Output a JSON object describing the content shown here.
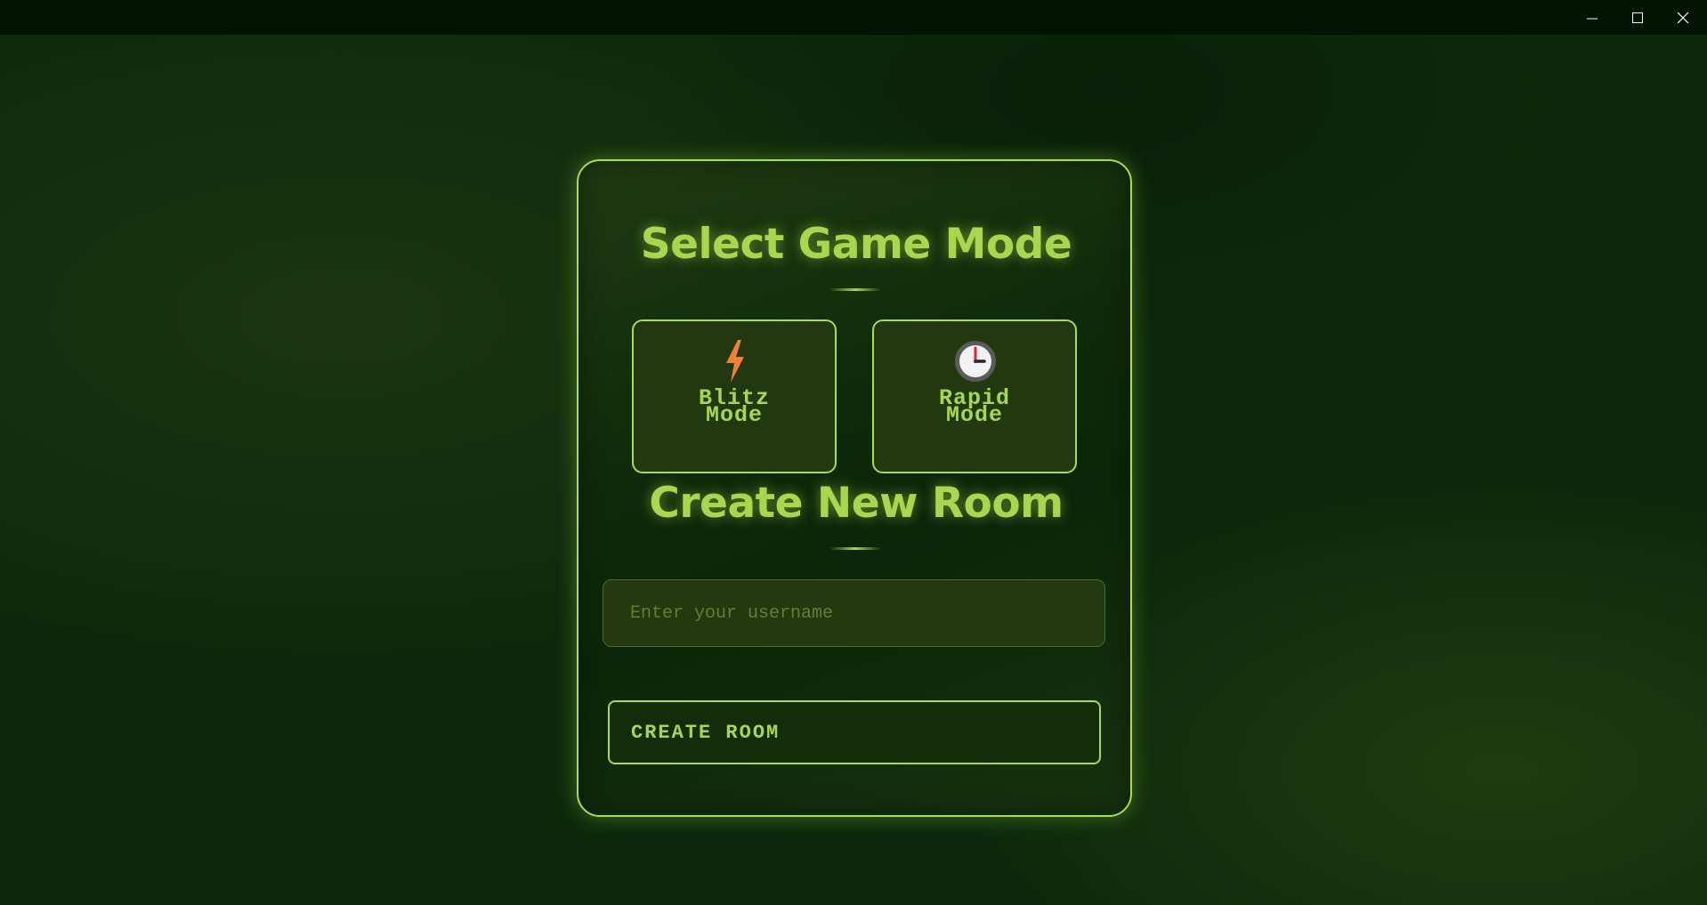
{
  "window": {
    "controls": [
      {
        "icon": "minimize-icon"
      },
      {
        "icon": "maximize-icon"
      },
      {
        "icon": "close-icon"
      }
    ]
  },
  "colors": {
    "accent": "#a7d84c",
    "lightning": "#f2802f",
    "background": "#0c2a0b"
  },
  "mode_section": {
    "title": "Select Game Mode",
    "modes": [
      {
        "icon": "lightning-icon",
        "line1": "Blitz",
        "line2": "Mode"
      },
      {
        "icon": "clock-icon",
        "line1": "Rapid",
        "line2": "Mode"
      }
    ]
  },
  "room_section": {
    "title": "Create New Room",
    "username_placeholder": "Enter your username",
    "create_button": "CREATE ROOM"
  }
}
